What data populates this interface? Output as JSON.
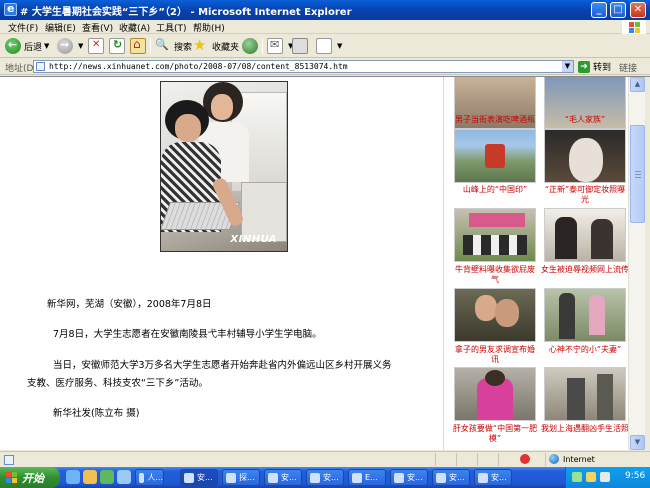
{
  "window": {
    "title": "# 大学生暑期社会实践“三下乡”（2） - Microsoft Internet Explorer"
  },
  "menu": [
    "文件(F)",
    "编辑(E)",
    "查看(V)",
    "收藏(A)",
    "工具(T)",
    "帮助(H)"
  ],
  "toolbar": {
    "back": "后退",
    "search": "搜索",
    "favorites": "收藏夹"
  },
  "address": {
    "label": "地址(D)",
    "url": "http://news.xinhuanet.com/photo/2008-07/08/content_8513074.htm",
    "go": "转到",
    "links": "链接"
  },
  "article": {
    "photo_watermark": "XINHUA",
    "paragraphs": [
      "新华网，芜湖（安徽），2008年7月8日",
      "7月8日，大学生志愿者在安徽南陵县弋丰村辅导小学生学电脑。",
      "当日，安徽师范大学3万多名大学生志愿者开始奔赴省内外偏远山区乡村开展义务",
      "支教、医疗服务、科技支农“三下乡”活动。",
      "新华社发(陈立布 摄)"
    ]
  },
  "sidebar": {
    "captions": [
      [
        "男子当街表演吃啤酒瓶",
        ""
      ],
      [
        "“毛人家族”",
        ""
      ],
      [
        "山峰上的“中国印”",
        ""
      ],
      [
        "“正新”泰可御定妆照曝",
        "光"
      ],
      [
        "牛背壁料曝收集欲屁废",
        "气"
      ],
      [
        "女生被迫辱视频网上流传",
        ""
      ],
      [
        "拿子的男友求调宣布婚",
        "讯"
      ],
      [
        "心神不宁的小“夫妻”",
        ""
      ],
      [
        "肝女孩要做“中国第一肥",
        "模”"
      ],
      [
        "我划上海遇翻凶手生活照",
        ""
      ]
    ]
  },
  "status": {
    "zone": "Internet"
  },
  "taskbar": {
    "start": "开始",
    "tasks": [
      "人...",
      "安...",
      "探...",
      "安...",
      "安...",
      "E...",
      "安...",
      "安...",
      "安..."
    ],
    "clock": "9:56"
  }
}
